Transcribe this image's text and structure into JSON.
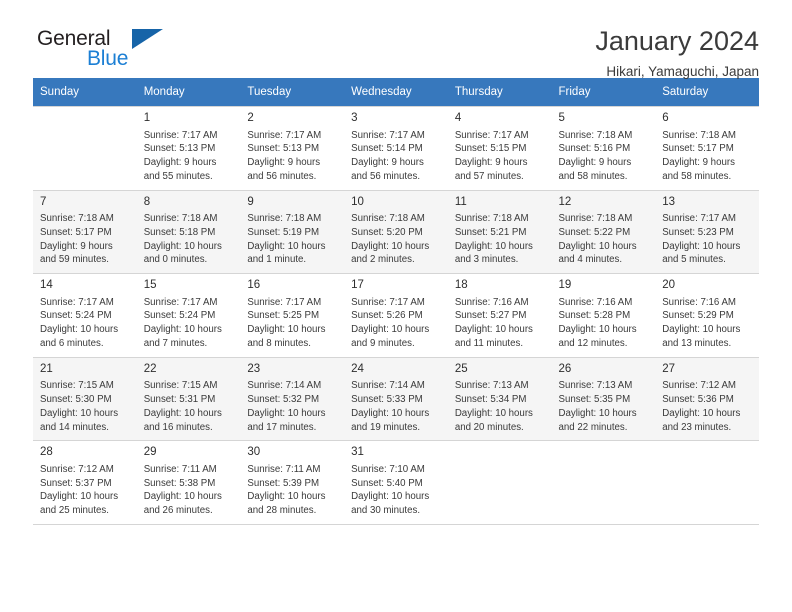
{
  "brand": {
    "name_top": "General",
    "name_bottom": "Blue",
    "accent_color": "#1c7fd4",
    "triangle_color": "#1664a8"
  },
  "header": {
    "title": "January 2024",
    "subtitle": "Hikari, Yamaguchi, Japan",
    "header_bg": "#3778bd"
  },
  "weekday_headers": [
    "Sunday",
    "Monday",
    "Tuesday",
    "Wednesday",
    "Thursday",
    "Friday",
    "Saturday"
  ],
  "weeks": [
    {
      "shaded": false,
      "days": [
        {
          "num": "",
          "sunrise": "",
          "sunset": "",
          "daylight_1": "",
          "daylight_2": "",
          "empty": true
        },
        {
          "num": "1",
          "sunrise": "Sunrise: 7:17 AM",
          "sunset": "Sunset: 5:13 PM",
          "daylight_1": "Daylight: 9 hours",
          "daylight_2": "and 55 minutes."
        },
        {
          "num": "2",
          "sunrise": "Sunrise: 7:17 AM",
          "sunset": "Sunset: 5:13 PM",
          "daylight_1": "Daylight: 9 hours",
          "daylight_2": "and 56 minutes."
        },
        {
          "num": "3",
          "sunrise": "Sunrise: 7:17 AM",
          "sunset": "Sunset: 5:14 PM",
          "daylight_1": "Daylight: 9 hours",
          "daylight_2": "and 56 minutes."
        },
        {
          "num": "4",
          "sunrise": "Sunrise: 7:17 AM",
          "sunset": "Sunset: 5:15 PM",
          "daylight_1": "Daylight: 9 hours",
          "daylight_2": "and 57 minutes."
        },
        {
          "num": "5",
          "sunrise": "Sunrise: 7:18 AM",
          "sunset": "Sunset: 5:16 PM",
          "daylight_1": "Daylight: 9 hours",
          "daylight_2": "and 58 minutes."
        },
        {
          "num": "6",
          "sunrise": "Sunrise: 7:18 AM",
          "sunset": "Sunset: 5:17 PM",
          "daylight_1": "Daylight: 9 hours",
          "daylight_2": "and 58 minutes."
        }
      ]
    },
    {
      "shaded": true,
      "days": [
        {
          "num": "7",
          "sunrise": "Sunrise: 7:18 AM",
          "sunset": "Sunset: 5:17 PM",
          "daylight_1": "Daylight: 9 hours",
          "daylight_2": "and 59 minutes."
        },
        {
          "num": "8",
          "sunrise": "Sunrise: 7:18 AM",
          "sunset": "Sunset: 5:18 PM",
          "daylight_1": "Daylight: 10 hours",
          "daylight_2": "and 0 minutes."
        },
        {
          "num": "9",
          "sunrise": "Sunrise: 7:18 AM",
          "sunset": "Sunset: 5:19 PM",
          "daylight_1": "Daylight: 10 hours",
          "daylight_2": "and 1 minute."
        },
        {
          "num": "10",
          "sunrise": "Sunrise: 7:18 AM",
          "sunset": "Sunset: 5:20 PM",
          "daylight_1": "Daylight: 10 hours",
          "daylight_2": "and 2 minutes."
        },
        {
          "num": "11",
          "sunrise": "Sunrise: 7:18 AM",
          "sunset": "Sunset: 5:21 PM",
          "daylight_1": "Daylight: 10 hours",
          "daylight_2": "and 3 minutes."
        },
        {
          "num": "12",
          "sunrise": "Sunrise: 7:18 AM",
          "sunset": "Sunset: 5:22 PM",
          "daylight_1": "Daylight: 10 hours",
          "daylight_2": "and 4 minutes."
        },
        {
          "num": "13",
          "sunrise": "Sunrise: 7:17 AM",
          "sunset": "Sunset: 5:23 PM",
          "daylight_1": "Daylight: 10 hours",
          "daylight_2": "and 5 minutes."
        }
      ]
    },
    {
      "shaded": false,
      "days": [
        {
          "num": "14",
          "sunrise": "Sunrise: 7:17 AM",
          "sunset": "Sunset: 5:24 PM",
          "daylight_1": "Daylight: 10 hours",
          "daylight_2": "and 6 minutes."
        },
        {
          "num": "15",
          "sunrise": "Sunrise: 7:17 AM",
          "sunset": "Sunset: 5:24 PM",
          "daylight_1": "Daylight: 10 hours",
          "daylight_2": "and 7 minutes."
        },
        {
          "num": "16",
          "sunrise": "Sunrise: 7:17 AM",
          "sunset": "Sunset: 5:25 PM",
          "daylight_1": "Daylight: 10 hours",
          "daylight_2": "and 8 minutes."
        },
        {
          "num": "17",
          "sunrise": "Sunrise: 7:17 AM",
          "sunset": "Sunset: 5:26 PM",
          "daylight_1": "Daylight: 10 hours",
          "daylight_2": "and 9 minutes."
        },
        {
          "num": "18",
          "sunrise": "Sunrise: 7:16 AM",
          "sunset": "Sunset: 5:27 PM",
          "daylight_1": "Daylight: 10 hours",
          "daylight_2": "and 11 minutes."
        },
        {
          "num": "19",
          "sunrise": "Sunrise: 7:16 AM",
          "sunset": "Sunset: 5:28 PM",
          "daylight_1": "Daylight: 10 hours",
          "daylight_2": "and 12 minutes."
        },
        {
          "num": "20",
          "sunrise": "Sunrise: 7:16 AM",
          "sunset": "Sunset: 5:29 PM",
          "daylight_1": "Daylight: 10 hours",
          "daylight_2": "and 13 minutes."
        }
      ]
    },
    {
      "shaded": true,
      "days": [
        {
          "num": "21",
          "sunrise": "Sunrise: 7:15 AM",
          "sunset": "Sunset: 5:30 PM",
          "daylight_1": "Daylight: 10 hours",
          "daylight_2": "and 14 minutes."
        },
        {
          "num": "22",
          "sunrise": "Sunrise: 7:15 AM",
          "sunset": "Sunset: 5:31 PM",
          "daylight_1": "Daylight: 10 hours",
          "daylight_2": "and 16 minutes."
        },
        {
          "num": "23",
          "sunrise": "Sunrise: 7:14 AM",
          "sunset": "Sunset: 5:32 PM",
          "daylight_1": "Daylight: 10 hours",
          "daylight_2": "and 17 minutes."
        },
        {
          "num": "24",
          "sunrise": "Sunrise: 7:14 AM",
          "sunset": "Sunset: 5:33 PM",
          "daylight_1": "Daylight: 10 hours",
          "daylight_2": "and 19 minutes."
        },
        {
          "num": "25",
          "sunrise": "Sunrise: 7:13 AM",
          "sunset": "Sunset: 5:34 PM",
          "daylight_1": "Daylight: 10 hours",
          "daylight_2": "and 20 minutes."
        },
        {
          "num": "26",
          "sunrise": "Sunrise: 7:13 AM",
          "sunset": "Sunset: 5:35 PM",
          "daylight_1": "Daylight: 10 hours",
          "daylight_2": "and 22 minutes."
        },
        {
          "num": "27",
          "sunrise": "Sunrise: 7:12 AM",
          "sunset": "Sunset: 5:36 PM",
          "daylight_1": "Daylight: 10 hours",
          "daylight_2": "and 23 minutes."
        }
      ]
    },
    {
      "shaded": false,
      "days": [
        {
          "num": "28",
          "sunrise": "Sunrise: 7:12 AM",
          "sunset": "Sunset: 5:37 PM",
          "daylight_1": "Daylight: 10 hours",
          "daylight_2": "and 25 minutes."
        },
        {
          "num": "29",
          "sunrise": "Sunrise: 7:11 AM",
          "sunset": "Sunset: 5:38 PM",
          "daylight_1": "Daylight: 10 hours",
          "daylight_2": "and 26 minutes."
        },
        {
          "num": "30",
          "sunrise": "Sunrise: 7:11 AM",
          "sunset": "Sunset: 5:39 PM",
          "daylight_1": "Daylight: 10 hours",
          "daylight_2": "and 28 minutes."
        },
        {
          "num": "31",
          "sunrise": "Sunrise: 7:10 AM",
          "sunset": "Sunset: 5:40 PM",
          "daylight_1": "Daylight: 10 hours",
          "daylight_2": "and 30 minutes."
        },
        {
          "num": "",
          "sunrise": "",
          "sunset": "",
          "daylight_1": "",
          "daylight_2": "",
          "empty": true
        },
        {
          "num": "",
          "sunrise": "",
          "sunset": "",
          "daylight_1": "",
          "daylight_2": "",
          "empty": true
        },
        {
          "num": "",
          "sunrise": "",
          "sunset": "",
          "daylight_1": "",
          "daylight_2": "",
          "empty": true
        }
      ]
    }
  ]
}
